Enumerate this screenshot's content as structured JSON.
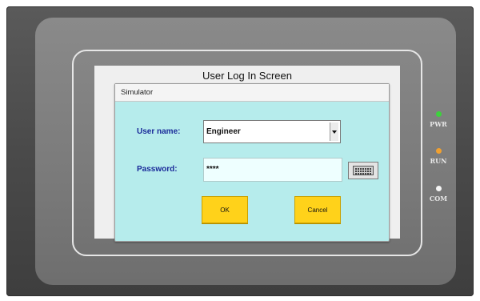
{
  "screen": {
    "title": "User Log In Screen"
  },
  "dialog": {
    "title": "Simulator",
    "username_label": "User name:",
    "username_value": "Engineer",
    "password_label": "Password:",
    "password_value": "****",
    "ok_label": "OK",
    "cancel_label": "Cancel",
    "keyboard_icon": "keyboard-icon"
  },
  "indicators": [
    {
      "label": "PWR",
      "color": "#3cd23c"
    },
    {
      "label": "RUN",
      "color": "#f0a030"
    },
    {
      "label": "COM",
      "color": "#f4f4f4"
    }
  ],
  "colors": {
    "dialog_bg": "#b6ecec",
    "label_text": "#1a2a99",
    "button_bg": "#ffd21a"
  }
}
